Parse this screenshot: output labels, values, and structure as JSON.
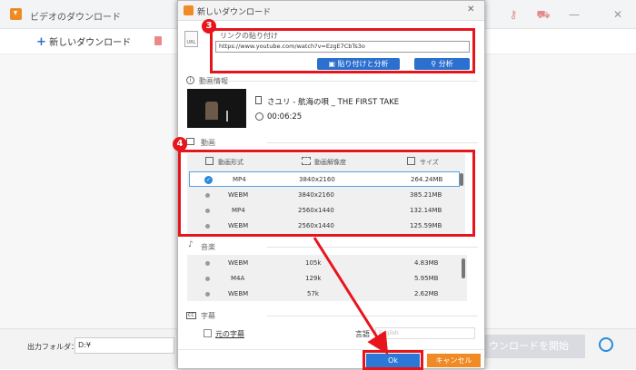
{
  "main": {
    "title": "ビデオのダウンロード",
    "new_download": "新しいダウンロード",
    "output_folder_label": "出力フォルダ：",
    "output_folder_value": "D:¥",
    "start_download_partial": "ウンロードを開始"
  },
  "dialog": {
    "title": "新しいダウンロード",
    "url_section": "リンクの貼り付け",
    "url_value": "https://www.youtube.com/watch?v=EzgE7CbTs3o",
    "paste_analyze": "貼り付けと分析",
    "analyze": "分析",
    "info_section": "動画情報",
    "video_title": "さユリ - 航海の唄 _ THE FIRST TAKE",
    "duration": "00:06:25",
    "video_section": "動画",
    "video_headers": [
      "動画形式",
      "動画解像度",
      "サイズ"
    ],
    "video_rows": [
      {
        "format": "MP4",
        "res": "3840x2160",
        "size": "264.24MB",
        "selected": true
      },
      {
        "format": "WEBM",
        "res": "3840x2160",
        "size": "385.21MB",
        "selected": false
      },
      {
        "format": "MP4",
        "res": "2560x1440",
        "size": "132.14MB",
        "selected": false
      },
      {
        "format": "WEBM",
        "res": "2560x1440",
        "size": "125.59MB",
        "selected": false
      }
    ],
    "audio_section": "音楽",
    "audio_rows": [
      {
        "format": "WEBM",
        "bitrate": "105k",
        "size": "4.83MB"
      },
      {
        "format": "M4A",
        "bitrate": "129k",
        "size": "5.95MB"
      },
      {
        "format": "WEBM",
        "bitrate": "57k",
        "size": "2.62MB"
      }
    ],
    "subtitle_section": "字幕",
    "original_subtitle": "元の字幕",
    "language_label": "言語",
    "language_value": "English",
    "ok": "Ok",
    "cancel": "キャンセル"
  },
  "badges": {
    "step3": "3",
    "step4": "4"
  },
  "colors": {
    "accent_red": "#e8141c",
    "blue": "#2b6fcf",
    "orange": "#f08a24"
  }
}
